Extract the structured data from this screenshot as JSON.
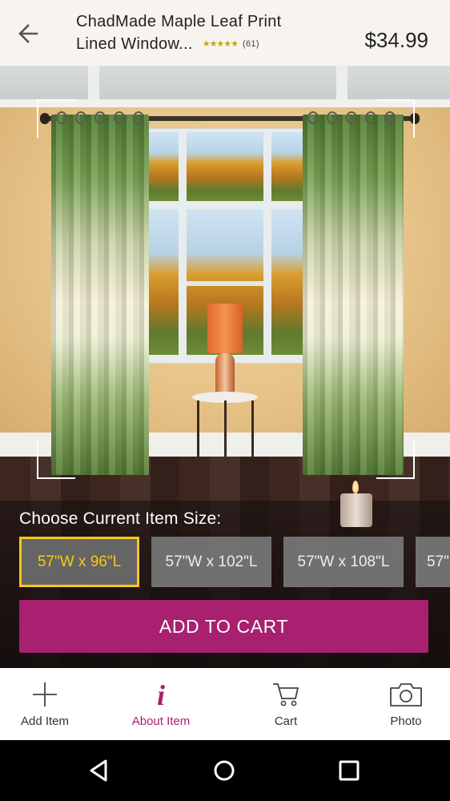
{
  "product": {
    "title_line1": "ChadMade Maple Leaf Print",
    "title_line2": "Lined Window...",
    "rating_stars": "★★★★★",
    "rating": 4.5,
    "review_count": "(61)",
    "price": "$34.99"
  },
  "size_chooser": {
    "label": "Choose Current Item Size:",
    "options": [
      "57\"W x 96\"L",
      "57\"W x 102\"L",
      "57\"W x 108\"L",
      "57\""
    ],
    "selected_index": 0
  },
  "actions": {
    "add_to_cart": "ADD TO CART"
  },
  "tabs": [
    {
      "label": "Add Item",
      "icon": "plus-icon"
    },
    {
      "label": "About Item",
      "icon": "info-icon",
      "glyph": "i"
    },
    {
      "label": "Cart",
      "icon": "cart-icon"
    },
    {
      "label": "Photo",
      "icon": "camera-icon"
    }
  ],
  "active_tab_index": 1,
  "colors": {
    "accent": "#a8206f",
    "selected_size": "#f4c81a"
  }
}
